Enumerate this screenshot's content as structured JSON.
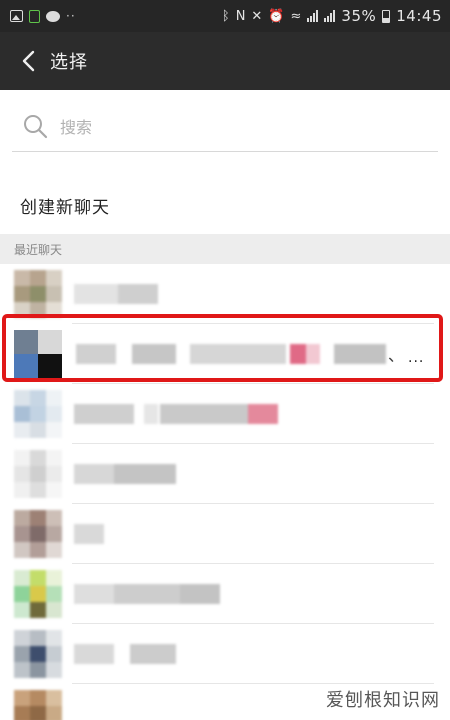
{
  "status_bar": {
    "battery_percent": "35%",
    "time": "14:45"
  },
  "header": {
    "title": "选择",
    "back_icon": "chevron-left-icon"
  },
  "search": {
    "placeholder": "搜索",
    "value": ""
  },
  "create_chat": {
    "label": "创建新聊天"
  },
  "recent": {
    "section_label": "最近聊天",
    "highlighted_row_index": 1
  },
  "highlighted_row": {
    "separator": "、",
    "overflow": "..."
  },
  "colors": {
    "highlight_border": "#e01818",
    "header_bg": "#2c2c2c",
    "status_bg": "#262626"
  },
  "watermark": "爱刨根知识网"
}
